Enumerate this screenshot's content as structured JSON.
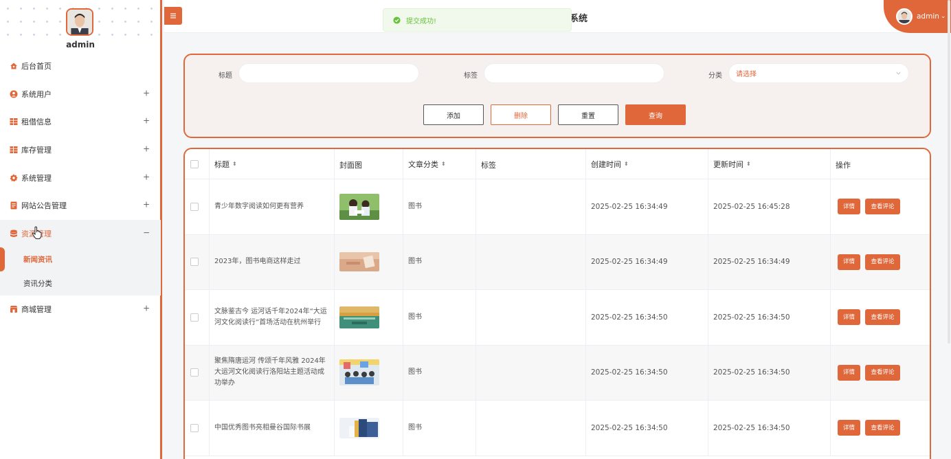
{
  "header": {
    "title_partial": "系统",
    "user_name": "admin",
    "user_caret": "⌄"
  },
  "toast": {
    "message": "提交成功!"
  },
  "sidebar": {
    "user_name": "admin",
    "items": [
      {
        "label": "后台首页",
        "icon": "home-icon",
        "expandable": false
      },
      {
        "label": "系统用户",
        "icon": "user-icon",
        "expandable": true,
        "toggle": "+"
      },
      {
        "label": "租借信息",
        "icon": "grid-icon",
        "expandable": true,
        "toggle": "+"
      },
      {
        "label": "库存管理",
        "icon": "grid-icon",
        "expandable": true,
        "toggle": "+"
      },
      {
        "label": "系统管理",
        "icon": "gear-icon",
        "expandable": true,
        "toggle": "+"
      },
      {
        "label": "网站公告管理",
        "icon": "document-icon",
        "expandable": true,
        "toggle": "+"
      },
      {
        "label": "资源管理",
        "icon": "database-icon",
        "expandable": true,
        "toggle": "−",
        "open": true
      },
      {
        "label": "商城管理",
        "icon": "shop-icon",
        "expandable": true,
        "toggle": "+"
      }
    ],
    "submenu": [
      {
        "label": "新闻资讯",
        "active": true
      },
      {
        "label": "资讯分类",
        "active": false
      }
    ]
  },
  "filters": {
    "title_label": "标题",
    "tag_label": "标签",
    "category_label": "分类",
    "category_placeholder": "请选择",
    "buttons": {
      "add": "添加",
      "delete": "删除",
      "reset": "重置",
      "search": "查询"
    }
  },
  "table": {
    "headers": {
      "title": "标题",
      "cover": "封面图",
      "category": "文章分类",
      "tags": "标签",
      "created": "创建时间",
      "updated": "更新时间",
      "actions": "操作"
    },
    "sort_glyph": "⬍",
    "rows": [
      {
        "title": "青少年数字阅读如何更有营养",
        "category": "图书",
        "tags": "",
        "created": "2025-02-25 16:34:49",
        "updated": "2025-02-25 16:45:28"
      },
      {
        "title": "2023年，图书电商这样走过",
        "category": "图书",
        "tags": "",
        "created": "2025-02-25 16:34:49",
        "updated": "2025-02-25 16:34:49"
      },
      {
        "title": "文脉鉴古今 运河话千年2024年“大运河文化阅读行”首场活动在杭州举行",
        "category": "图书",
        "tags": "",
        "created": "2025-02-25 16:34:50",
        "updated": "2025-02-25 16:34:50"
      },
      {
        "title": "聚焦隋唐运河 传颂千年风雅 2024年大运河文化阅读行洛阳站主题活动成功举办",
        "category": "图书",
        "tags": "",
        "created": "2025-02-25 16:34:50",
        "updated": "2025-02-25 16:34:50"
      },
      {
        "title": "中国优秀图书亮相曼谷国际书展",
        "category": "图书",
        "tags": "",
        "created": "2025-02-25 16:34:50",
        "updated": "2025-02-25 16:34:50"
      }
    ],
    "action_labels": {
      "detail": "详情",
      "comments": "查看评论"
    }
  },
  "colors": {
    "accent": "#e0673a",
    "success": "#67c23a",
    "row_alt": "#f7f7f7"
  }
}
